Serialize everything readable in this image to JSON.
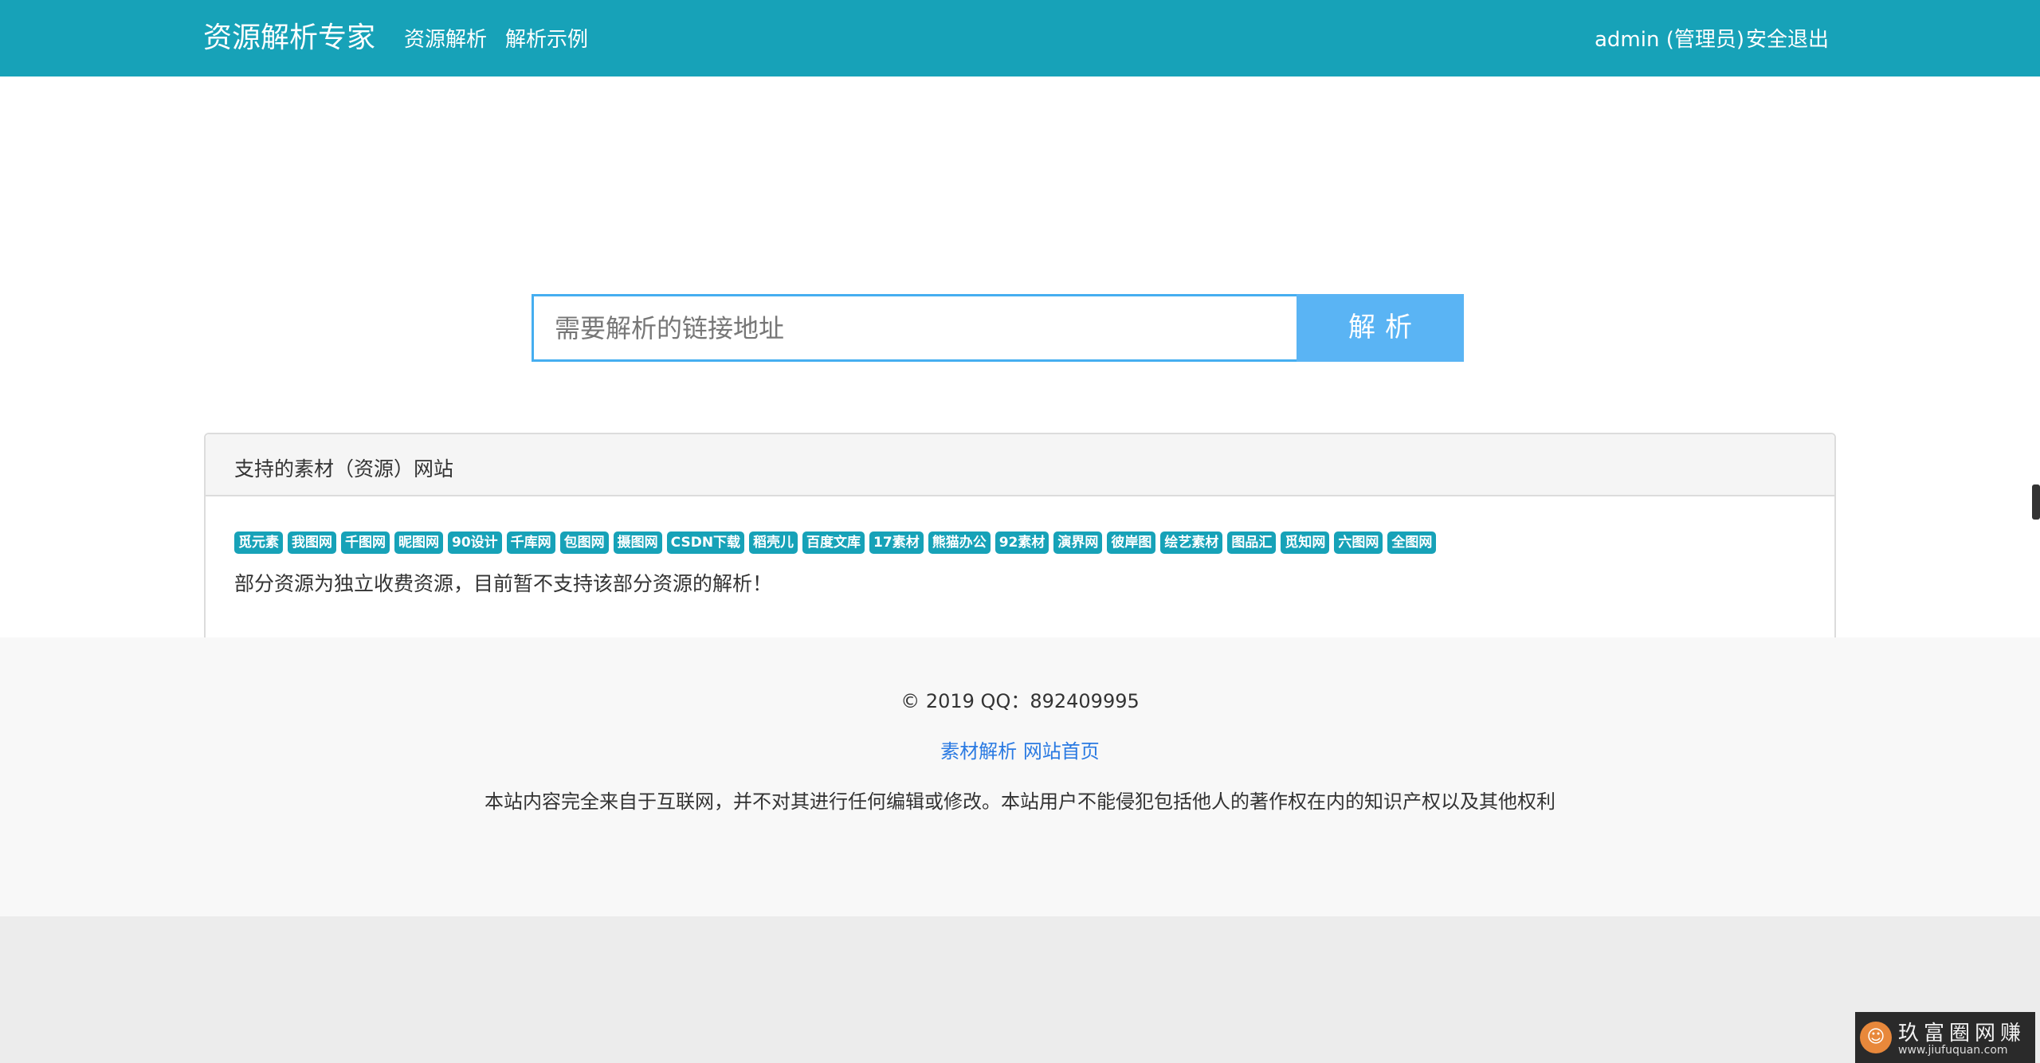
{
  "navbar": {
    "brand": "资源解析专家",
    "links": [
      "资源解析",
      "解析示例"
    ],
    "user": "admin (管理员)",
    "logout": "安全退出",
    "color": "#17a2b8"
  },
  "search": {
    "placeholder": "需要解析的链接地址",
    "value": "",
    "button": "解析"
  },
  "panel": {
    "title": "支持的素材（资源）网站",
    "tags": [
      "觅元素",
      "我图网",
      "千图网",
      "昵图网",
      "90设计",
      "千库网",
      "包图网",
      "摄图网",
      "CSDN下载",
      "稻壳儿",
      "百度文库",
      "17素材",
      "熊猫办公",
      "92素材",
      "演界网",
      "彼岸图",
      "绘艺素材",
      "图品汇",
      "觅知网",
      "六图网",
      "全图网"
    ],
    "notice": "部分资源为独立收费资源，目前暂不支持该部分资源的解析！"
  },
  "footer": {
    "copyright": "© 2019 QQ：892409995",
    "links": [
      "素材解析",
      "网站首页"
    ],
    "disclaimer": "本站内容完全来自于互联网，并不对其进行任何编辑或修改。本站用户不能侵犯包括他人的著作权在内的知识产权以及其他权利"
  },
  "watermark": {
    "text": "玖富圈网赚",
    "url": "www.jiufuquan.com"
  }
}
